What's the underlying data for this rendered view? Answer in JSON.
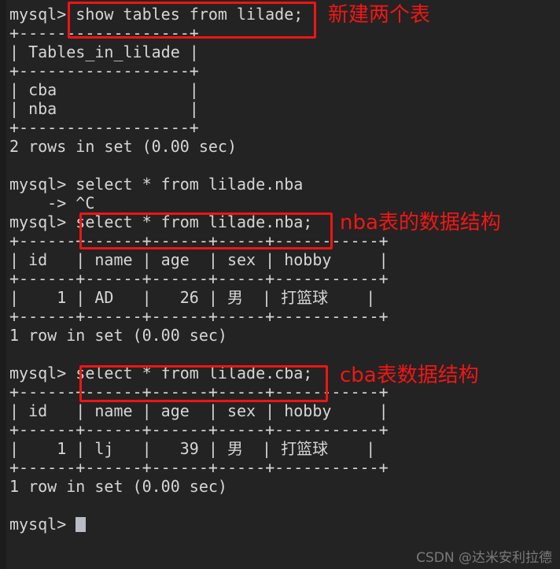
{
  "terminal": {
    "prompt": "mysql> ",
    "continuation_prompt": "    -> ",
    "lines": [
      "mysql> show tables from lilade;",
      "+------------------+",
      "| Tables_in_lilade |",
      "+------------------+",
      "| cba              |",
      "| nba              |",
      "+------------------+",
      "2 rows in set (0.00 sec)",
      "",
      "mysql> select * from lilade.nba",
      "    -> ^C",
      "mysql> select * from lilade.nba;",
      "+------+------+------+-----+-----------+",
      "| id   | name | age  | sex | hobby     |",
      "+------+------+------+-----+-----------+",
      "|    1 | AD   |   26 | 男  | 打篮球    |",
      "+------+------+------+-----+-----------+",
      "1 row in set (0.00 sec)",
      "",
      "mysql> select * from lilade.cba;",
      "+------+------+------+-----+-----------+",
      "| id   | name | age  | sex | hobby     |",
      "+------+------+------+-----+-----------+",
      "|    1 | lj   |   39 | 男  | 打篮球    |",
      "+------+------+------+-----+-----------+",
      "1 row in set (0.00 sec)",
      "",
      "mysql> "
    ]
  },
  "queries": {
    "show_tables": "show tables from lilade;",
    "select_nba_incomplete": "select * from lilade.nba",
    "interrupt": "^C",
    "select_nba": "select * from lilade.nba;",
    "select_cba": "select * from lilade.cba;"
  },
  "results": {
    "show_tables": {
      "column": "Tables_in_lilade",
      "rows": [
        "cba",
        "nba"
      ],
      "status": "2 rows in set (0.00 sec)"
    },
    "nba": {
      "columns": [
        "id",
        "name",
        "age",
        "sex",
        "hobby"
      ],
      "rows": [
        [
          "1",
          "AD",
          "26",
          "男",
          "打篮球"
        ]
      ],
      "status": "1 row in set (0.00 sec)"
    },
    "cba": {
      "columns": [
        "id",
        "name",
        "age",
        "sex",
        "hobby"
      ],
      "rows": [
        [
          "1",
          "lj",
          "39",
          "男",
          "打篮球"
        ]
      ],
      "status": "1 row in set (0.00 sec)"
    }
  },
  "annotations": {
    "new_tables": "新建两个表",
    "nba_structure": "nba表的数据结构",
    "cba_structure": "cba表数据结构"
  },
  "watermark": "CSDN @达米安利拉德",
  "colors": {
    "background": "#232323",
    "text": "#d6d6d6",
    "annotation_red": "#f21616",
    "box_red": "#f01414",
    "cursor": "#b9bcc4",
    "watermark": "#8a8a8a"
  }
}
